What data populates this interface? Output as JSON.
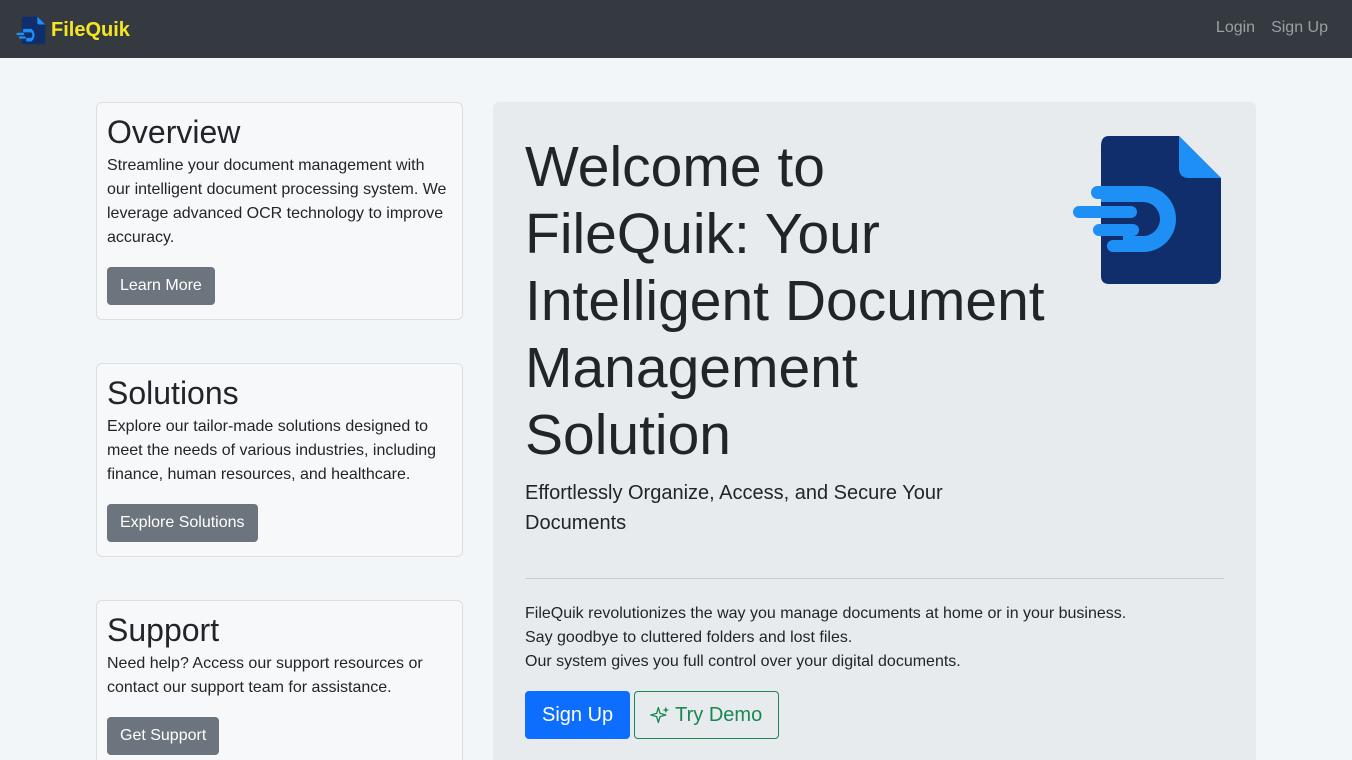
{
  "nav": {
    "brand": "FileQuik",
    "links": [
      {
        "label": "Login"
      },
      {
        "label": "Sign Up"
      }
    ]
  },
  "cards": [
    {
      "title": "Overview",
      "text": "Streamline your document management with our intelligent document processing system. We leverage advanced OCR technology to improve accuracy.",
      "button": "Learn More"
    },
    {
      "title": "Solutions",
      "text": "Explore our tailor-made solutions designed to meet the needs of various industries, including finance, human resources, and healthcare.",
      "button": "Explore Solutions"
    },
    {
      "title": "Support",
      "text": "Need help? Access our support resources or contact our support team for assistance.",
      "button": "Get Support"
    }
  ],
  "hero": {
    "title": "Welcome to FileQuik: Your Intelligent Document Management Solution",
    "subtitle": "Effortlessly Organize, Access, and Secure Your Documents",
    "body_lines": [
      "FileQuik revolutionizes the way you manage documents at home or in your business.",
      "Say goodbye to cluttered folders and lost files.",
      "Our system gives you full control over your digital documents."
    ],
    "primary_button": "Sign Up",
    "secondary_button": "Try Demo"
  },
  "icons": {
    "brand_logo": "document-speed-icon",
    "hero_logo": "document-speed-icon",
    "demo": "sparkle-icon"
  },
  "colors": {
    "navbar": "#343a40",
    "brand": "#f5e623",
    "primary": "#0d6efd",
    "success": "#198754",
    "secondary": "#6c757d",
    "logo_dark": "#0f2e6b",
    "logo_light": "#1e90f5"
  }
}
